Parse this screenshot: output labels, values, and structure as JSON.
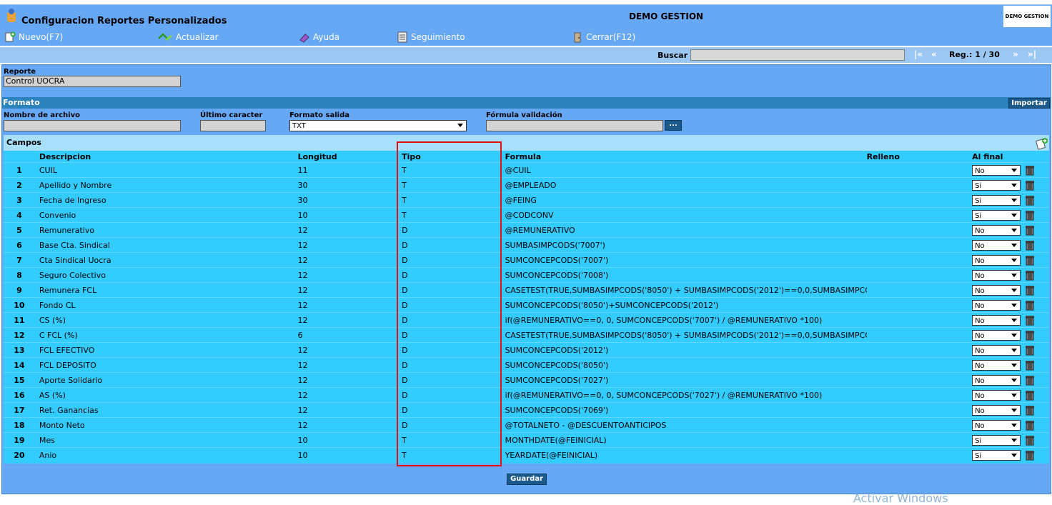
{
  "window": {
    "title": "Configuracion Reportes Personalizados",
    "company": "DEMO GESTION",
    "logo_text": "DEMO GESTION"
  },
  "toolbar": {
    "nuevo": "Nuevo(F7)",
    "actualizar": "Actualizar",
    "ayuda": "Ayuda",
    "seguimiento": "Seguimiento",
    "cerrar": "Cerrar(F12)"
  },
  "search": {
    "label": "Buscar",
    "value": "",
    "first": "|«",
    "prev": "«",
    "reg": "Reg.: 1 / 30",
    "next": "»",
    "last": "»|"
  },
  "reporte": {
    "label": "Reporte",
    "value": "Control UOCRA"
  },
  "formato": {
    "title": "Formato",
    "importar": "Importar",
    "nombre_archivo_label": "Nombre de archivo",
    "nombre_archivo_value": "",
    "ultimo_caracter_label": "Último caracter",
    "ultimo_caracter_value": "",
    "formato_salida_label": "Formato salida",
    "formato_salida_value": "TXT",
    "formula_validacion_label": "Fórmula validación",
    "formula_validacion_value": "",
    "browse_button": "..."
  },
  "campos": {
    "title": "Campos",
    "columns": {
      "descripcion": "Descripcion",
      "longitud": "Longitud",
      "tipo": "Tipo",
      "formula": "Formula",
      "relleno": "Relleno",
      "al_final": "Al final"
    },
    "rows": [
      {
        "n": "1",
        "desc": "CUIL",
        "long": "11",
        "tipo": "T",
        "formula": "@CUIL",
        "relleno": "",
        "al_final": "No"
      },
      {
        "n": "2",
        "desc": "Apellido y Nombre",
        "long": "30",
        "tipo": "T",
        "formula": "@EMPLEADO",
        "relleno": "",
        "al_final": "Si"
      },
      {
        "n": "3",
        "desc": "Fecha de Ingreso",
        "long": "30",
        "tipo": "T",
        "formula": "@FEING",
        "relleno": "",
        "al_final": "Si"
      },
      {
        "n": "4",
        "desc": "Convenio",
        "long": "10",
        "tipo": "T",
        "formula": "@CODCONV",
        "relleno": "",
        "al_final": "Si"
      },
      {
        "n": "5",
        "desc": "Remunerativo",
        "long": "12",
        "tipo": "D",
        "formula": " @REMUNERATIVO",
        "relleno": "",
        "al_final": "No"
      },
      {
        "n": "6",
        "desc": "Base Cta. Sindical",
        "long": "12",
        "tipo": "D",
        "formula": "SUMBASIMPCODS('7007')",
        "relleno": "",
        "al_final": "No"
      },
      {
        "n": "7",
        "desc": "Cta Sindical Uocra",
        "long": "12",
        "tipo": "D",
        "formula": "SUMCONCEPCODS('7007')",
        "relleno": "",
        "al_final": "No"
      },
      {
        "n": "8",
        "desc": "Seguro Colectivo",
        "long": "12",
        "tipo": "D",
        "formula": "SUMCONCEPCODS('7008')",
        "relleno": "",
        "al_final": "No"
      },
      {
        "n": "9",
        "desc": "Remunera FCL",
        "long": "12",
        "tipo": "D",
        "formula": "CASETEST(TRUE,SUMBASIMPCODS('8050') +  SUMBASIMPCODS('2012')==0,0,SUMBASIMPCODS",
        "relleno": "",
        "al_final": "No"
      },
      {
        "n": "10",
        "desc": "Fondo CL",
        "long": "12",
        "tipo": "D",
        "formula": "SUMCONCEPCODS('8050')+SUMCONCEPCODS('2012')",
        "relleno": "",
        "al_final": "No"
      },
      {
        "n": "11",
        "desc": "CS (%)",
        "long": "12",
        "tipo": "D",
        "formula": " if(@REMUNERATIVO==0, 0, SUMCONCEPCODS('7007') / @REMUNERATIVO *100)",
        "relleno": "",
        "al_final": "No"
      },
      {
        "n": "12",
        "desc": "C FCL (%)",
        "long": "6",
        "tipo": "D",
        "formula": " CASETEST(TRUE,SUMBASIMPCODS('8050') +  SUMBASIMPCODS('2012')==0,0,SUMBASIMPCODS",
        "relleno": "",
        "al_final": "No"
      },
      {
        "n": "13",
        "desc": "FCL EFECTIVO",
        "long": "12",
        "tipo": "D",
        "formula": "SUMCONCEPCODS('2012')",
        "relleno": "",
        "al_final": "No"
      },
      {
        "n": "14",
        "desc": "FCL DEPOSITO",
        "long": "12",
        "tipo": "D",
        "formula": "SUMCONCEPCODS('8050')",
        "relleno": "",
        "al_final": "No"
      },
      {
        "n": "15",
        "desc": "Aporte Solidario",
        "long": "12",
        "tipo": "D",
        "formula": "SUMCONCEPCODS('7027')",
        "relleno": "",
        "al_final": "No"
      },
      {
        "n": "16",
        "desc": "AS (%)",
        "long": "12",
        "tipo": "D",
        "formula": " if(@REMUNERATIVO==0, 0, SUMCONCEPCODS('7027') / @REMUNERATIVO *100)",
        "relleno": "",
        "al_final": "No"
      },
      {
        "n": "17",
        "desc": "Ret. Ganancias",
        "long": "12",
        "tipo": "D",
        "formula": "SUMCONCEPCODS('7069')",
        "relleno": "",
        "al_final": "No"
      },
      {
        "n": "18",
        "desc": "Monto Neto",
        "long": "12",
        "tipo": "D",
        "formula": "@TOTALNETO - @DESCUENTOANTICIPOS",
        "relleno": "",
        "al_final": "No"
      },
      {
        "n": "19",
        "desc": "Mes",
        "long": "10",
        "tipo": "T",
        "formula": "MONTHDATE(@FEINICIAL)",
        "relleno": "",
        "al_final": "Si"
      },
      {
        "n": "20",
        "desc": "Anio",
        "long": "10",
        "tipo": "T",
        "formula": "YEARDATE(@FEINICIAL)",
        "relleno": "",
        "al_final": "Si"
      }
    ]
  },
  "guardar": "Guardar",
  "watermark": "Activar Windows",
  "colors": {
    "panel": "#67a8f5",
    "grid": "#33ccff",
    "highlight": "#e01010",
    "button": "#1d5a8c"
  }
}
